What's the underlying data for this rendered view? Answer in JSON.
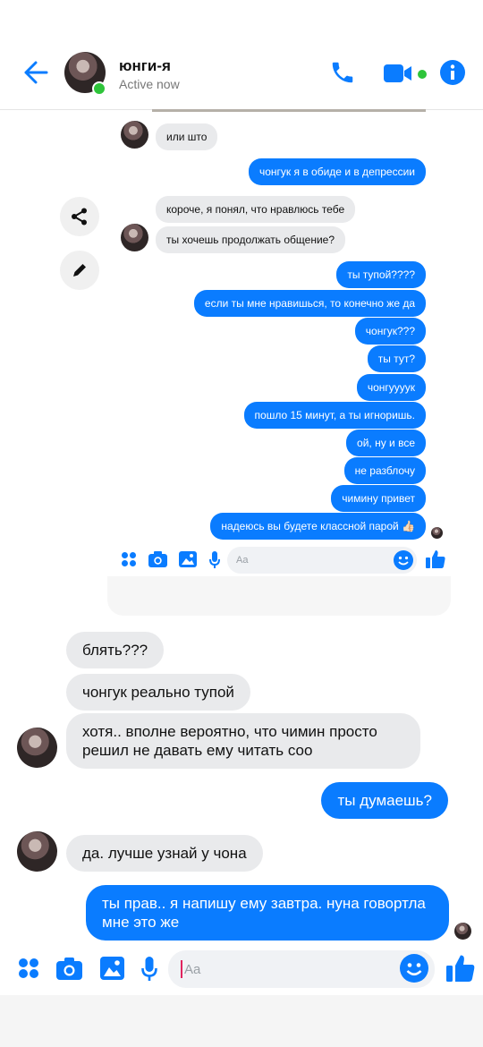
{
  "header": {
    "contact_name": "юнги-я",
    "status": "Active now"
  },
  "inner_chat": {
    "messages": [
      {
        "from": "them",
        "text": "или што"
      },
      {
        "from": "me",
        "text": "чонгук я в обиде и в депрессии"
      },
      {
        "from": "them",
        "text": "короче, я понял, что нравлюсь тебе"
      },
      {
        "from": "them",
        "text": "ты хочешь продолжать общение?"
      },
      {
        "from": "me",
        "text": "ты тупой????"
      },
      {
        "from": "me",
        "text": "если ты мне нравишься, то конечно же да"
      },
      {
        "from": "me",
        "text": "чонгук???"
      },
      {
        "from": "me",
        "text": "ты тут?"
      },
      {
        "from": "me",
        "text": "чонгуууук"
      },
      {
        "from": "me",
        "text": "пошло 15 минут, а ты игноришь."
      },
      {
        "from": "me",
        "text": "ой, ну и все"
      },
      {
        "from": "me",
        "text": "не разблочу"
      },
      {
        "from": "me",
        "text": "чимину привет"
      },
      {
        "from": "me",
        "text": "надеюсь вы будете классной парой 👍🏻"
      }
    ],
    "composer_placeholder": "Aa"
  },
  "chat": {
    "messages": [
      {
        "from": "them",
        "text": "блять???"
      },
      {
        "from": "them",
        "text": "чонгук реально тупой"
      },
      {
        "from": "them",
        "text": "хотя.. вполне вероятно, что чимин просто решил не давать ему читать соо"
      },
      {
        "from": "me",
        "text": "ты думаешь?"
      },
      {
        "from": "them",
        "text": "да. лучше узнай у чона"
      },
      {
        "from": "me",
        "text": "ты прав.. я напишу ему завтра. нуна говортла мне это же"
      }
    ]
  },
  "composer": {
    "placeholder": "Aa"
  },
  "colors": {
    "accent": "#0a7cff",
    "bubble_in": "#e9eaec",
    "online": "#2ec43a"
  }
}
